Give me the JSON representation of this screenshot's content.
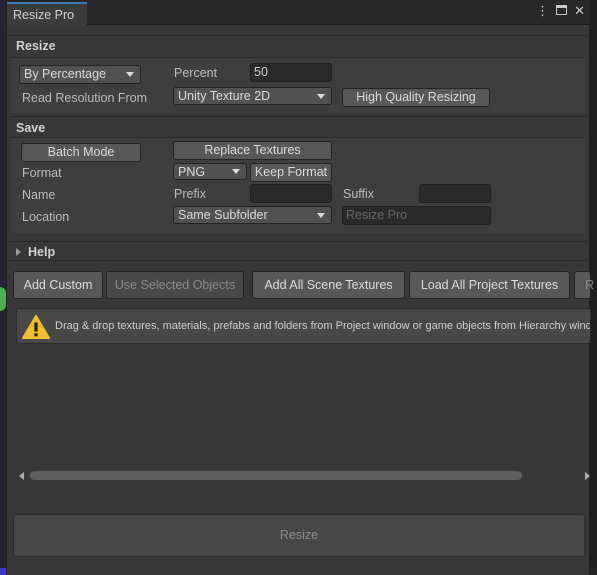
{
  "window": {
    "tab_title": "Resize Pro",
    "menu_icon": "kebab-menu-icon",
    "maximize_icon": "maximize-icon",
    "close_icon": "close-icon"
  },
  "resize_section": {
    "title": "Resize",
    "mode_dropdown": "By Percentage",
    "percent_label": "Percent",
    "percent_value": "50",
    "read_resolution_label": "Read Resolution From",
    "read_resolution_dropdown": "Unity Texture 2D",
    "high_quality_button": "High Quality Resizing"
  },
  "save_section": {
    "title": "Save",
    "batch_mode_button": "Batch Mode",
    "replace_textures_button": "Replace Textures",
    "format_label": "Format",
    "format_dropdown": "PNG",
    "keep_format_button": "Keep Format",
    "name_label": "Name",
    "prefix_label": "Prefix",
    "prefix_value": "",
    "suffix_label": "Suffix",
    "suffix_value": "",
    "location_label": "Location",
    "location_dropdown": "Same Subfolder",
    "folder_placeholder": "Resize Pro"
  },
  "help": {
    "title": "Help"
  },
  "toolbar": {
    "add_custom": "Add Custom",
    "use_selected": "Use Selected Objects",
    "add_scene_textures": "Add All Scene Textures",
    "load_project_textures": "Load All Project Textures",
    "overflow_button": "R"
  },
  "info": {
    "icon": "warning-icon",
    "message": "Drag & drop textures, materials, prefabs and folders from Project window or game objects from Hierarchy window"
  },
  "footer": {
    "resize_button": "Resize"
  }
}
